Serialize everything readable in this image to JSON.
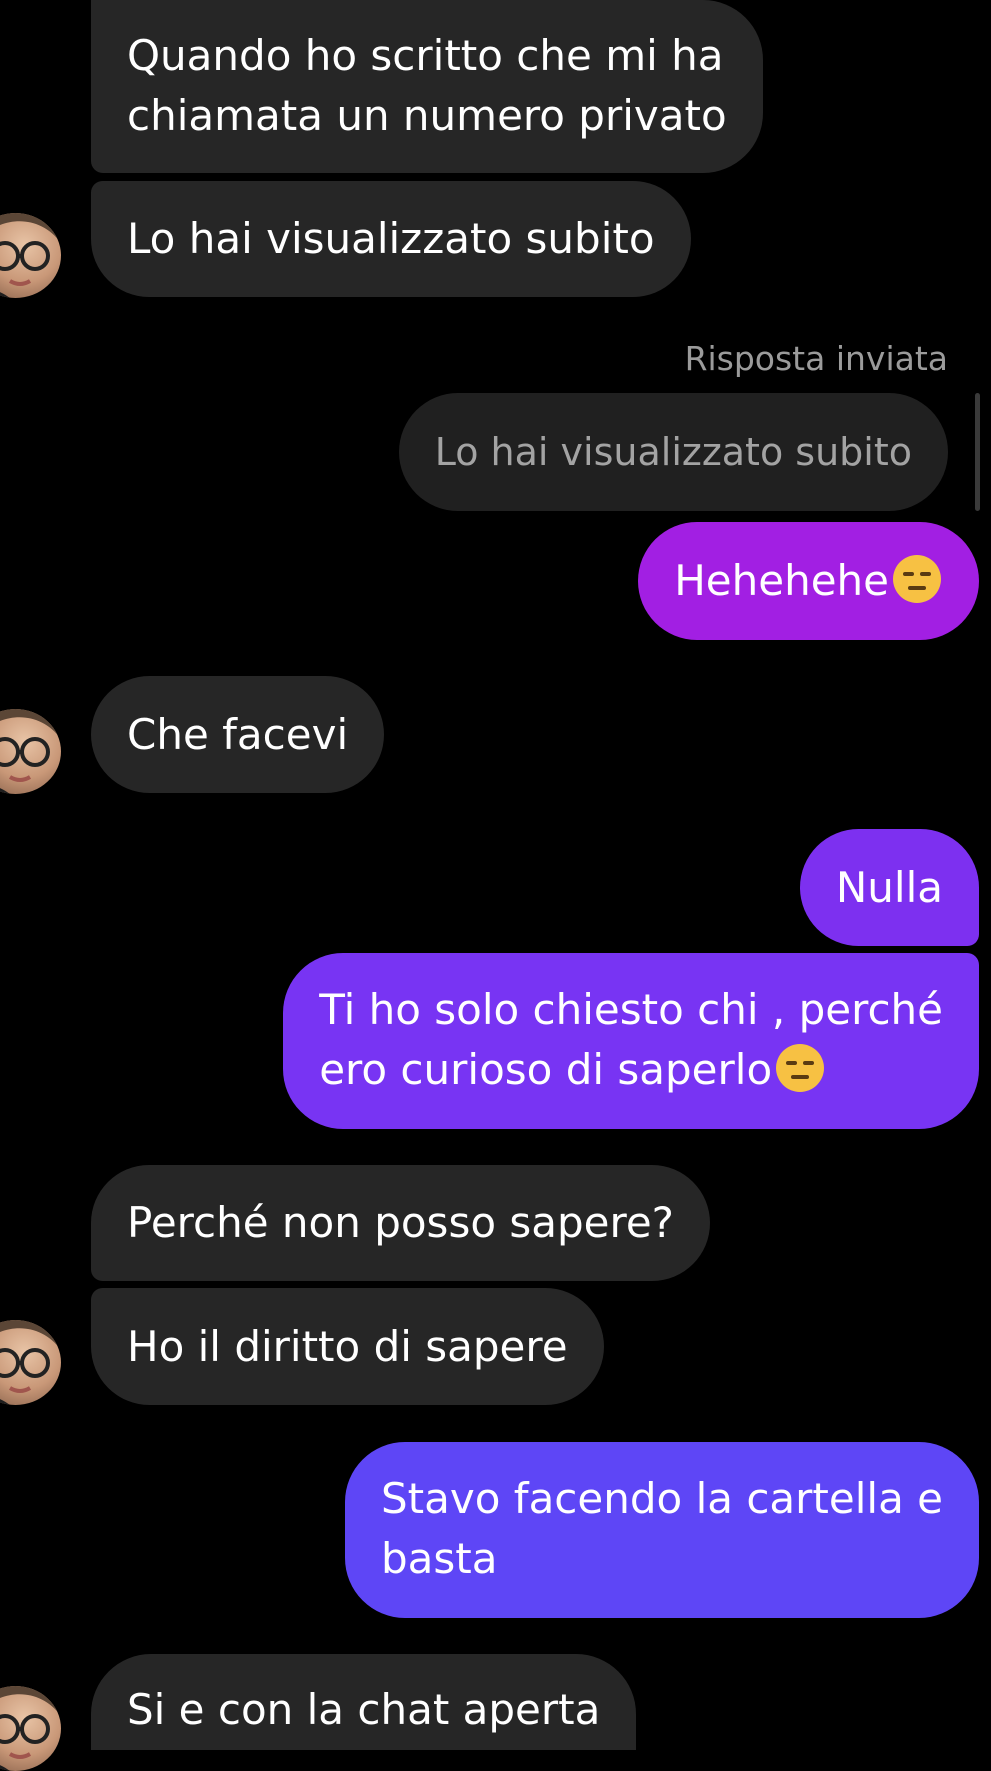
{
  "messages": [
    {
      "id": "m1",
      "direction": "incoming",
      "lines": [
        "Quando ho scritto che mi ha",
        "chiamata un numero privato"
      ]
    },
    {
      "id": "m2",
      "direction": "incoming",
      "lines": [
        "Lo hai visualizzato subito"
      ],
      "has_avatar": true
    },
    {
      "id": "m3",
      "direction": "outgoing",
      "reply_caption": "Risposta inviata",
      "quoted_text": "Lo hai visualizzato subito",
      "lines": [
        "Hehehehe"
      ],
      "trailing_emoji": "expressionless-face-icon",
      "color": "#a21fe3"
    },
    {
      "id": "m4",
      "direction": "incoming",
      "lines": [
        "Che facevi"
      ],
      "has_avatar": true
    },
    {
      "id": "m5",
      "direction": "outgoing",
      "lines": [
        "Nulla"
      ],
      "color": "#7d30f0"
    },
    {
      "id": "m6",
      "direction": "outgoing",
      "lines": [
        "Ti ho solo chiesto chi , perché",
        "ero curioso di saperlo"
      ],
      "trailing_emoji": "expressionless-face-icon",
      "color": "#7834f3"
    },
    {
      "id": "m7",
      "direction": "incoming",
      "lines": [
        "Perché non posso sapere?"
      ]
    },
    {
      "id": "m8",
      "direction": "incoming",
      "lines": [
        "Ho il diritto di sapere"
      ],
      "has_avatar": true
    },
    {
      "id": "m9",
      "direction": "outgoing",
      "lines": [
        "Stavo facendo la cartella e",
        "basta"
      ],
      "color": "#5e46f6"
    },
    {
      "id": "m10",
      "direction": "incoming",
      "lines": [
        "Si e con la chat aperta"
      ],
      "has_avatar": true
    }
  ],
  "colors": {
    "background": "#000000",
    "incoming_bubble": "#262626",
    "quoted_bubble": "#202020",
    "caption_text": "#9b9b9b"
  }
}
